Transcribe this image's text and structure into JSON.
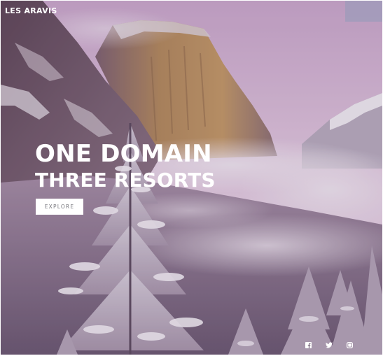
{
  "header": {
    "brand": "LES ARAVIS"
  },
  "hero": {
    "title_line1": "ONE DOMAIN",
    "title_line2": "THREE RESORTS",
    "cta_label": "EXPLORE"
  },
  "social": [
    {
      "icon": "facebook-icon"
    },
    {
      "icon": "twitter-icon"
    },
    {
      "icon": "instagram-icon"
    }
  ],
  "colors": {
    "sky_pink": "#d9b7d6",
    "mist": "#e8dde8",
    "cliff": "#b78b58",
    "shadow_purple": "#4c3c50",
    "button_text": "#7a7a80"
  }
}
